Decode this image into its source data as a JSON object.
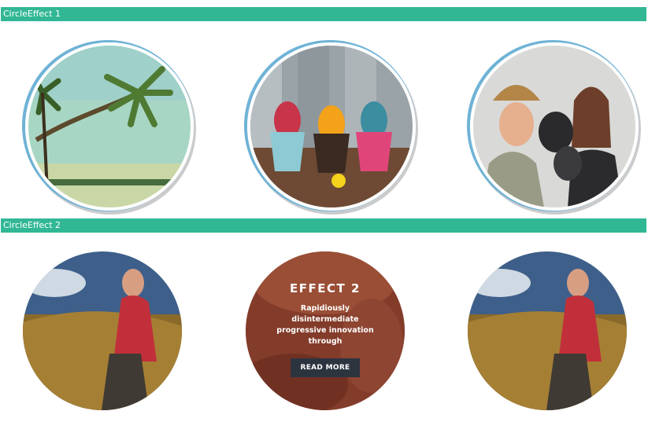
{
  "sections": [
    {
      "title": "CircleEffect 1"
    },
    {
      "title": "CircleEffect 2"
    }
  ],
  "images": {
    "palm": "palm-beach-photo",
    "eggs": "easter-eggs-photo",
    "boxing": "boxing-couple-photo",
    "woman": "woman-in-field-photo"
  },
  "effect2": {
    "title": "EFFECT 2",
    "text": "Rapidiously disintermediate progressive innovation through",
    "button": "READ MORE"
  },
  "colors": {
    "accent": "#32b795",
    "ring_blue": "#6fb3d6",
    "ring_gray": "#c9cbcd",
    "button_bg": "#2c3440"
  }
}
